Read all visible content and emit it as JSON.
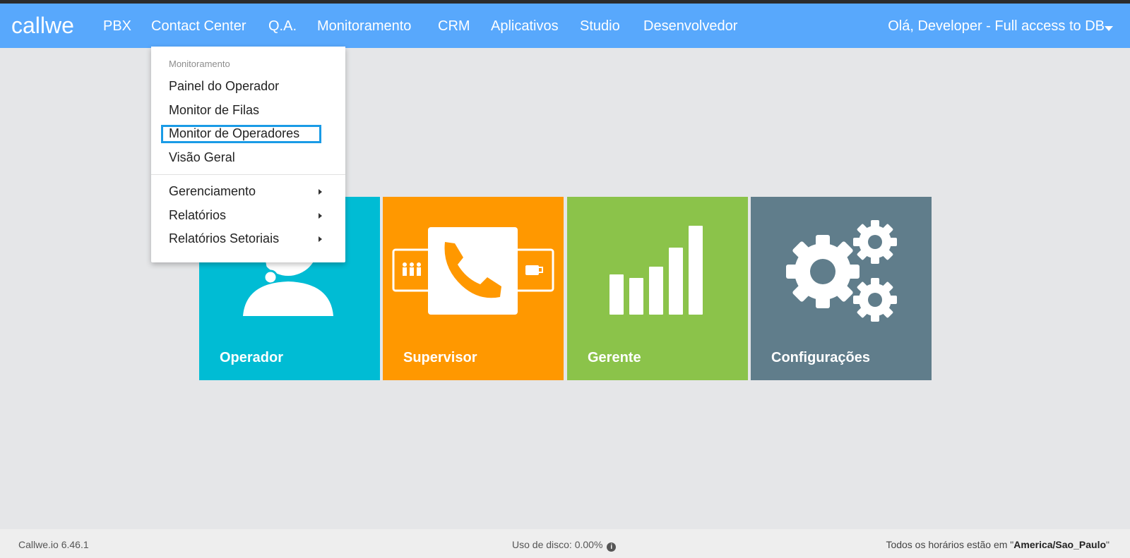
{
  "app": {
    "logo_text": "callwe"
  },
  "nav": {
    "items": [
      {
        "label": "PBX"
      },
      {
        "label": "Contact Center"
      },
      {
        "label": "Q.A."
      },
      {
        "label": "Monitoramento"
      },
      {
        "label": "CRM"
      },
      {
        "label": "Aplicativos"
      },
      {
        "label": "Studio"
      },
      {
        "label": "Desenvolvedor"
      }
    ],
    "user_label": "Olá, Developer - Full access to DB"
  },
  "dropdown": {
    "header": "Monitoramento",
    "items": [
      {
        "label": "Painel do Operador"
      },
      {
        "label": "Monitor de Filas"
      },
      {
        "label": "Monitor de Operadores"
      },
      {
        "label": "Visão Geral"
      }
    ],
    "submenus": [
      {
        "label": "Gerenciamento"
      },
      {
        "label": "Relatórios"
      },
      {
        "label": "Relatórios Setoriais"
      }
    ],
    "highlighted_index": 2
  },
  "tiles": [
    {
      "label": "Operador",
      "color": "#00bcd4",
      "icon": "headset-operator-icon"
    },
    {
      "label": "Supervisor",
      "color": "#ff9800",
      "icon": "phone-queue-icon"
    },
    {
      "label": "Gerente",
      "color": "#8bc34a",
      "icon": "bar-chart-icon"
    },
    {
      "label": "Configurações",
      "color": "#607d8b",
      "icon": "gears-icon"
    }
  ],
  "footer": {
    "version": "Callwe.io 6.46.1",
    "disk_usage_label": "Uso de disco: 0.00%",
    "timezone_prefix": "Todos os horários estão em \"",
    "timezone": "America/Sao_Paulo",
    "timezone_suffix": "\""
  },
  "colors": {
    "navbar": "#58a8fc",
    "background": "#e5e6e8",
    "highlight_border": "#1a9be6"
  }
}
